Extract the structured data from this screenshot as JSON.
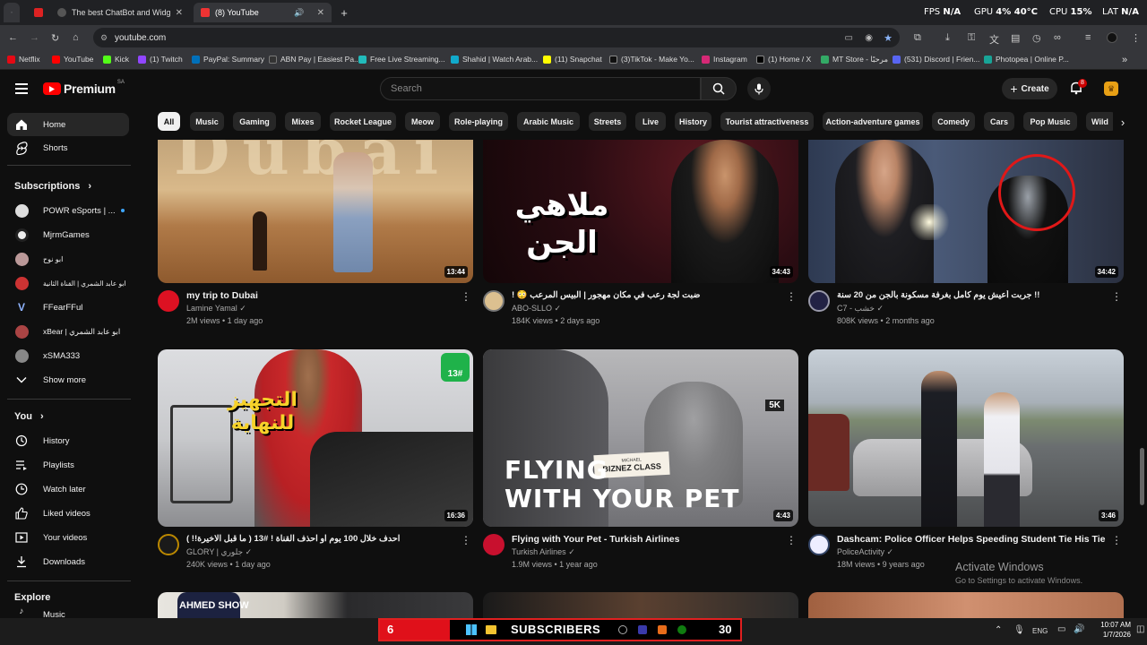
{
  "browser": {
    "tabs": [
      {
        "title": "",
        "color": "#d22"
      },
      {
        "title": "The best ChatBot and Widgets",
        "color": "#666"
      },
      {
        "title": "(8) YouTube",
        "color": "#e33"
      }
    ],
    "perf": {
      "fps_label": "FPS",
      "fps_value": "N/A",
      "gpu_label": "GPU",
      "gpu_value": "4% 40°C",
      "cpu_label": "CPU",
      "cpu_value": "15%",
      "lat_label": "LAT",
      "lat_value": "N/A"
    },
    "url": "youtube.com",
    "bookmarks": [
      {
        "label": "Netflix",
        "color": "#e50914"
      },
      {
        "label": "YouTube",
        "color": "#ff0000"
      },
      {
        "label": "Kick",
        "color": "#53fc18"
      },
      {
        "label": "(1) Twitch",
        "color": "#9146ff"
      },
      {
        "label": "PayPal: Summary",
        "color": "#0070ba"
      },
      {
        "label": "ABN Pay | Easiest Pa...",
        "color": "#333"
      },
      {
        "label": "Free Live Streaming...",
        "color": "#2bb"
      },
      {
        "label": "Shahid | Watch Arab...",
        "color": "#1ac"
      },
      {
        "label": "(11) Snapchat",
        "color": "#fffc00"
      },
      {
        "label": "(3)TikTok - Make Yo...",
        "color": "#111"
      },
      {
        "label": "Instagram",
        "color": "#d62976"
      },
      {
        "label": "(1) Home / X",
        "color": "#000"
      },
      {
        "label": "MT Store - مرحبًا",
        "color": "#3a6"
      },
      {
        "label": "(531) Discord | Frien...",
        "color": "#5865f2"
      },
      {
        "label": "Photopea | Online P...",
        "color": "#18a497"
      }
    ]
  },
  "header": {
    "logo": "Premium",
    "region": "SA",
    "search_placeholder": "Search",
    "create_label": "Create",
    "notif_count": "8"
  },
  "chips": [
    "All",
    "Music",
    "Gaming",
    "Mixes",
    "Rocket League",
    "Meow",
    "Role-playing",
    "Arabic Music",
    "Streets",
    "Live",
    "History",
    "Tourist attractiveness",
    "Action-adventure games",
    "Comedy",
    "Cars",
    "Pop Music",
    "Wild"
  ],
  "sidebar": {
    "home": "Home",
    "shorts": "Shorts",
    "subscriptions_title": "Subscriptions",
    "subscriptions": [
      {
        "name": "POWR eSports | ...",
        "color": "#ddd"
      },
      {
        "name": "MjrmGames",
        "color": "#eee"
      },
      {
        "name": "ابو نوح",
        "color": "#b99"
      },
      {
        "name": "ابو عابد الشمري | القناة الثانية",
        "color": "#c33"
      },
      {
        "name": "FFearFFul",
        "color": "#36c"
      },
      {
        "name": "xBear | ابو عابد الشمري",
        "color": "#a44"
      },
      {
        "name": "xSMA333",
        "color": "#888"
      }
    ],
    "show_more": "Show more",
    "you_title": "You",
    "you_items": [
      "History",
      "Playlists",
      "Watch later",
      "Liked videos",
      "Your videos",
      "Downloads"
    ],
    "explore_title": "Explore",
    "explore_partial": "Music"
  },
  "videos": [
    {
      "title": "my trip to Dubai",
      "channel": "Lamine Yamal",
      "views": "2M views",
      "age": "1 day ago",
      "duration": "13:44",
      "avatar": "#d12"
    },
    {
      "title": "! 😳 ضبت لجة رعب في مكان مهجور | البيس المرعب",
      "channel": "ABO-SLLO",
      "views": "184K views",
      "age": "2 days ago",
      "duration": "34:43",
      "avatar": "#dcc090"
    },
    {
      "title": "جربت أعيش يوم كامل بغرفة مسكونة بالجن من 20 سنة !!",
      "channel": "C7 - خشب",
      "views": "808K views",
      "age": "2 months ago",
      "duration": "34:42",
      "avatar": "#224"
    },
    {
      "title": "احدف خلال 100 يوم او احذف القناة ! #13 ( ما قبل الاخيرة!! )",
      "channel": "GLORY | جلوري",
      "views": "240K views",
      "age": "1 day ago",
      "duration": "16:36",
      "avatar": "#b80"
    },
    {
      "title": "Flying with Your Pet - Turkish Airlines",
      "channel": "Turkish Airlines",
      "views": "1.9M views",
      "age": "1 year ago",
      "duration": "4:43",
      "avatar": "#c8102e"
    },
    {
      "title": "Dashcam: Police Officer Helps Speeding Student Tie His Tie",
      "channel": "PoliceActivity",
      "views": "18M views",
      "age": "9 years ago",
      "duration": "3:46",
      "avatar": "#eef"
    }
  ],
  "thumb_text": {
    "dubai": "Dubai",
    "jinn": "ملاهي الجن",
    "prep": "التجهيز للنهاية",
    "badge13": "13#",
    "flying1": "FLYING",
    "flying2": "WITH YOUR PET",
    "biznez_small": "MICHAEL",
    "biznez": "BIZNEZ CLASS",
    "fivek": "5K",
    "ahmed": "AHMED SHOW"
  },
  "activate": {
    "line1": "Activate Windows",
    "line2": "Go to Settings to activate Windows."
  },
  "taskbar": {
    "sub_left": "6",
    "sub_label": "SUBSCRIBERS",
    "sub_right": "30",
    "lang": "ENG",
    "time": "10:07 AM",
    "date": "1/7/2026"
  }
}
